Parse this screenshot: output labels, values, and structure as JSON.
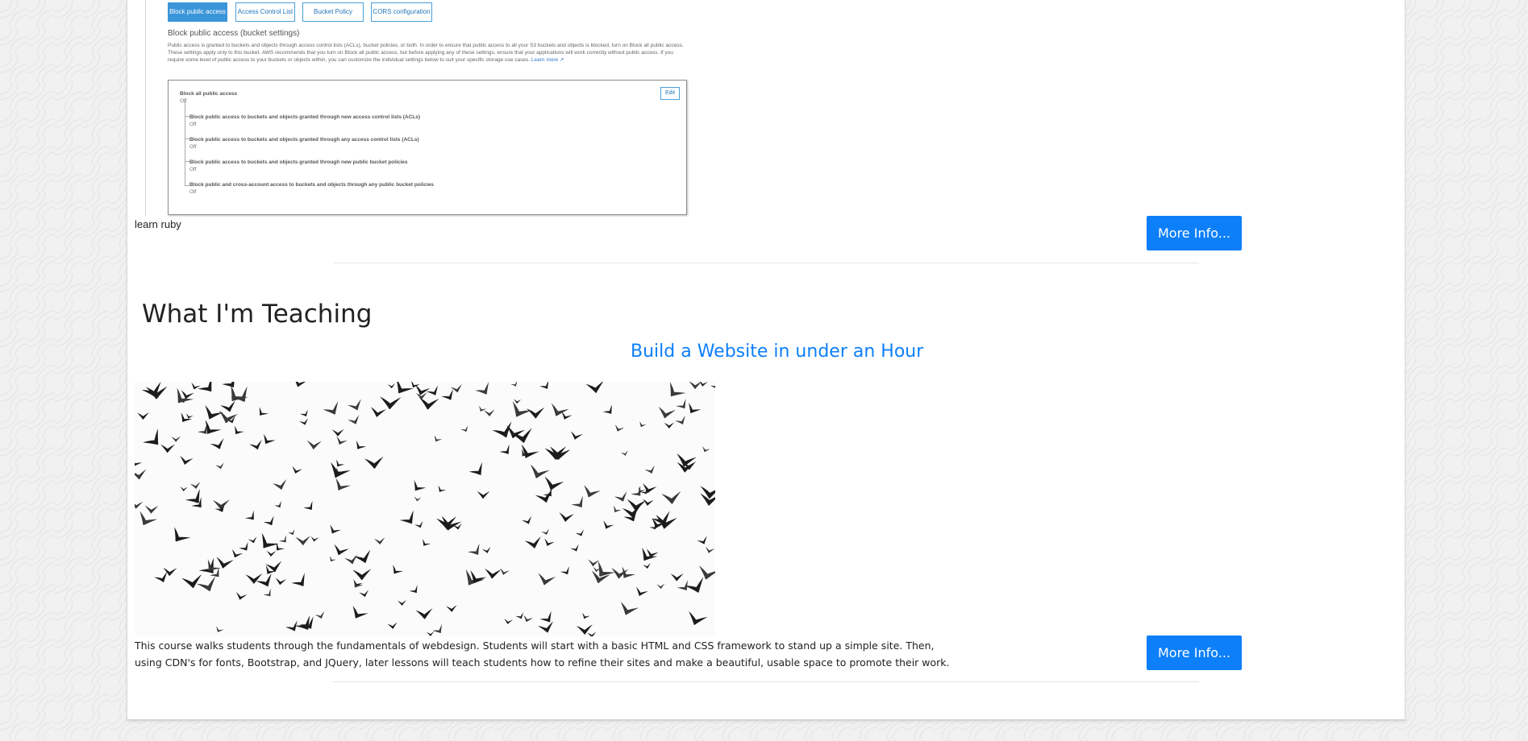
{
  "screenshot": {
    "tabs": [
      "Block public access",
      "Access Control List",
      "Bucket Policy",
      "CORS configuration"
    ],
    "heading": "Block public access (bucket settings)",
    "paragraph": "Public access is granted to buckets and objects through access control lists (ACLs), bucket policies, or both. In order to ensure that public access to all your S3 buckets and objects is blocked, turn on Block all public access. These settings apply only to this bucket. AWS recommends that you turn on Block all public access, but before applying any of these settings, ensure that your applications will work correctly without public access. If you require some level of public access to your buckets or objects within, you can customize the individual settings below to suit your specific storage use cases.",
    "learn_more": "Learn more",
    "edit_label": "Edit",
    "main_setting": {
      "title": "Block all public access",
      "value": "Off"
    },
    "sub_settings": [
      {
        "title": "Block public access to buckets and objects granted through new access control lists (ACLs)",
        "value": "Off"
      },
      {
        "title": "Block public access to buckets and objects granted through any access control lists (ACLs)",
        "value": "Off"
      },
      {
        "title": "Block public access to buckets and objects granted through new public bucket policies",
        "value": "Off"
      },
      {
        "title": "Block public and cross-account access to buckets and objects through any public bucket policies",
        "value": "Off"
      }
    ]
  },
  "item1": {
    "caption": "learn ruby",
    "button": "More Info..."
  },
  "teaching": {
    "section_title": "What I'm Teaching",
    "course_title": "Build a Website in under an Hour",
    "description": "This course walks students through the fundamentals of webdesign. Students will start with a basic HTML and CSS framework to stand up a simple site. Then, using CDN's for fonts, Bootstrap, and JQuery, later lessons will teach students how to refine their sites and make a beautiful, usable space to promote their work.",
    "button": "More Info..."
  },
  "colors": {
    "accent": "#0d7ff9",
    "text": "#222222",
    "panel": "#ffffff"
  }
}
